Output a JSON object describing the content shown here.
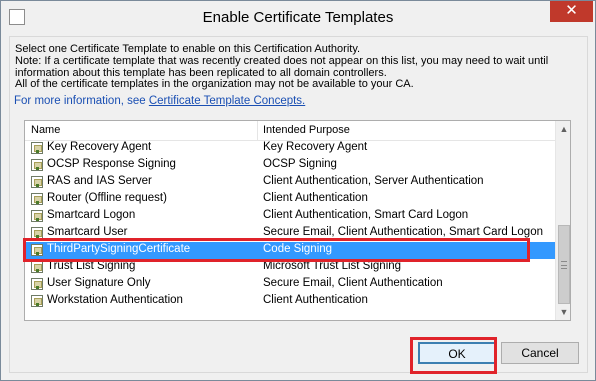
{
  "window": {
    "title": "Enable Certificate Templates",
    "close_label": "✕"
  },
  "description": {
    "line1": "Select one Certificate Template to enable on this Certification Authority.",
    "line2": "Note: If a certificate template that was recently created does not appear on this list, you may need to wait until",
    "line3": "information about this template has been replicated to all domain controllers.",
    "line4": "All of the certificate templates in the organization may not be available to your CA.",
    "link_prefix": "For more information, see ",
    "link_text": "Certificate Template Concepts."
  },
  "list": {
    "columns": [
      "Name",
      "Intended Purpose"
    ],
    "rows": [
      {
        "name": "Key Recovery Agent",
        "purpose": "Key Recovery Agent"
      },
      {
        "name": "OCSP Response Signing",
        "purpose": "OCSP Signing"
      },
      {
        "name": "RAS and IAS Server",
        "purpose": "Client Authentication, Server Authentication"
      },
      {
        "name": "Router (Offline request)",
        "purpose": "Client Authentication"
      },
      {
        "name": "Smartcard Logon",
        "purpose": "Client Authentication, Smart Card Logon"
      },
      {
        "name": "Smartcard User",
        "purpose": "Secure Email, Client Authentication, Smart Card Logon"
      },
      {
        "name": "ThirdPartySigningCertificate",
        "purpose": "Code Signing"
      },
      {
        "name": "Trust List Signing",
        "purpose": "Microsoft Trust List Signing"
      },
      {
        "name": "User Signature Only",
        "purpose": "Secure Email, Client Authentication"
      },
      {
        "name": "Workstation Authentication",
        "purpose": "Client Authentication"
      }
    ],
    "selected_index": 6
  },
  "buttons": {
    "ok": "OK",
    "cancel": "Cancel"
  },
  "colors": {
    "selection": "#3399ff",
    "highlight_box": "#e0232a",
    "link": "#1a4fb3"
  }
}
